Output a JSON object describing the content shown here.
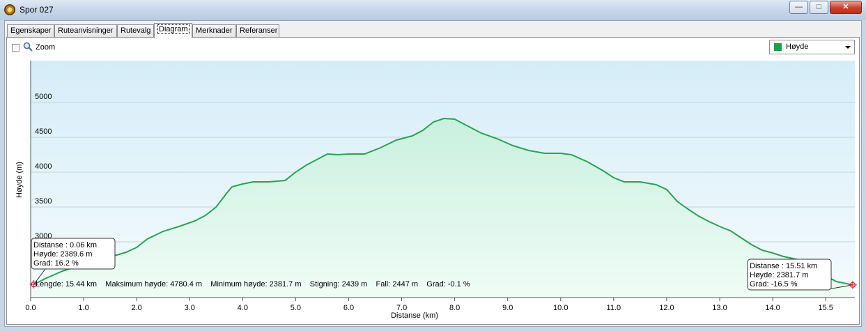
{
  "window": {
    "title": "Spor 027",
    "minimize_glyph": "—",
    "maximize_glyph": "□",
    "close_glyph": "✕"
  },
  "tabs": [
    {
      "label": "Egenskaper",
      "active": false
    },
    {
      "label": "Ruteanvisninger",
      "active": false
    },
    {
      "label": "Rutevalg",
      "active": false
    },
    {
      "label": "Diagram",
      "active": true
    },
    {
      "label": "Merknader",
      "active": false
    },
    {
      "label": "Referanser",
      "active": false
    }
  ],
  "toolbar": {
    "zoom_label": "Zoom",
    "zoom_checked": false,
    "series_select_value": "Høyde",
    "series_color": "#1aa04b"
  },
  "chart_data": {
    "type": "area",
    "xlabel": "Distanse  (km)",
    "ylabel": "Høyde (m)",
    "xlim": [
      0,
      15.55
    ],
    "ylim": [
      2200,
      5600
    ],
    "xticks": [
      0.0,
      1.0,
      2.0,
      3.0,
      4.0,
      5.0,
      6.0,
      7.0,
      8.0,
      9.0,
      10.0,
      11.0,
      12.0,
      13.0,
      14.0,
      15.0
    ],
    "xtick_labels": [
      "0.0",
      "1.0",
      "2.0",
      "3.0",
      "4.0",
      "5.0",
      "6.0",
      "7.0",
      "8.0",
      "9.0",
      "10.0",
      "11.0",
      "12.0",
      "13.0",
      "14.0",
      "15.5"
    ],
    "yticks": [
      3000,
      3500,
      4000,
      4500,
      5000
    ],
    "ytick_labels": [
      "3000",
      "3500",
      "4000",
      "4500",
      "5000"
    ],
    "grid": true,
    "series": [
      {
        "color": "#2aa24f",
        "points": [
          [
            0.06,
            2390
          ],
          [
            0.3,
            2480
          ],
          [
            0.6,
            2580
          ],
          [
            1.0,
            2680
          ],
          [
            1.4,
            2760
          ],
          [
            1.8,
            2850
          ],
          [
            2.0,
            2920
          ],
          [
            2.2,
            3040
          ],
          [
            2.5,
            3150
          ],
          [
            2.8,
            3220
          ],
          [
            3.1,
            3300
          ],
          [
            3.3,
            3380
          ],
          [
            3.5,
            3500
          ],
          [
            3.7,
            3700
          ],
          [
            3.8,
            3790
          ],
          [
            4.0,
            3830
          ],
          [
            4.2,
            3860
          ],
          [
            4.5,
            3860
          ],
          [
            4.8,
            3880
          ],
          [
            5.0,
            4000
          ],
          [
            5.2,
            4100
          ],
          [
            5.4,
            4180
          ],
          [
            5.6,
            4260
          ],
          [
            5.8,
            4250
          ],
          [
            6.0,
            4260
          ],
          [
            6.3,
            4260
          ],
          [
            6.6,
            4350
          ],
          [
            6.9,
            4460
          ],
          [
            7.2,
            4520
          ],
          [
            7.4,
            4600
          ],
          [
            7.6,
            4720
          ],
          [
            7.8,
            4770
          ],
          [
            8.0,
            4760
          ],
          [
            8.2,
            4680
          ],
          [
            8.5,
            4560
          ],
          [
            8.8,
            4480
          ],
          [
            9.1,
            4380
          ],
          [
            9.4,
            4310
          ],
          [
            9.7,
            4270
          ],
          [
            10.0,
            4270
          ],
          [
            10.2,
            4250
          ],
          [
            10.5,
            4150
          ],
          [
            10.8,
            4020
          ],
          [
            11.0,
            3920
          ],
          [
            11.2,
            3860
          ],
          [
            11.5,
            3860
          ],
          [
            11.8,
            3820
          ],
          [
            12.0,
            3750
          ],
          [
            12.2,
            3580
          ],
          [
            12.4,
            3470
          ],
          [
            12.6,
            3370
          ],
          [
            12.8,
            3290
          ],
          [
            13.0,
            3220
          ],
          [
            13.2,
            3160
          ],
          [
            13.4,
            3060
          ],
          [
            13.6,
            2960
          ],
          [
            13.8,
            2880
          ],
          [
            14.0,
            2840
          ],
          [
            14.2,
            2790
          ],
          [
            14.5,
            2740
          ],
          [
            14.8,
            2620
          ],
          [
            15.0,
            2510
          ],
          [
            15.2,
            2430
          ],
          [
            15.51,
            2382
          ]
        ]
      }
    ],
    "markers": [
      {
        "x": 0.06,
        "y": 2389.6,
        "lines": [
          "Distanse  : 0.06 km",
          "Høyde: 2389.6 m",
          "Grad: 16.2 %"
        ]
      },
      {
        "x": 15.51,
        "y": 2381.7,
        "lines": [
          "Distanse  : 15.51 km",
          "Høyde: 2381.7 m",
          "Grad: -16.5 %"
        ]
      }
    ],
    "summary": "Lengde: 15.44 km    Maksimum høyde: 4780.4 m    Minimum høyde: 2381.7 m    Stigning: 2439 m    Fall: 2447 m    Grad: -0.1 %"
  }
}
